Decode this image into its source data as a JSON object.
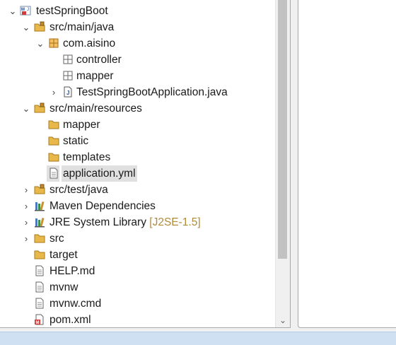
{
  "tree": {
    "rows": [
      {
        "label": "testSpringBoot",
        "icon": "maven-project-icon",
        "expanded": true
      },
      {
        "label": "src/main/java",
        "icon": "source-folder-icon",
        "expanded": true
      },
      {
        "label": "com.aisino",
        "icon": "package-icon",
        "expanded": true
      },
      {
        "label": "controller",
        "icon": "empty-package-icon"
      },
      {
        "label": "mapper",
        "icon": "empty-package-icon"
      },
      {
        "label": "TestSpringBootApplication.java",
        "icon": "java-file-icon",
        "expanded": false
      },
      {
        "label": "src/main/resources",
        "icon": "source-folder-icon",
        "expanded": true
      },
      {
        "label": "mapper",
        "icon": "folder-icon"
      },
      {
        "label": "static",
        "icon": "folder-icon"
      },
      {
        "label": "templates",
        "icon": "folder-icon"
      },
      {
        "label": "application.yml",
        "icon": "text-file-icon",
        "selected": true
      },
      {
        "label": "src/test/java",
        "icon": "source-folder-icon",
        "expanded": false
      },
      {
        "label": "Maven Dependencies",
        "icon": "library-icon",
        "expanded": false
      },
      {
        "label": "JRE System Library",
        "decoration": "[J2SE-1.5]",
        "icon": "library-icon",
        "expanded": false
      },
      {
        "label": "src",
        "icon": "folder-icon",
        "expanded": false
      },
      {
        "label": "target",
        "icon": "folder-icon"
      },
      {
        "label": "HELP.md",
        "icon": "text-file-icon"
      },
      {
        "label": "mvnw",
        "icon": "text-file-icon"
      },
      {
        "label": "mvnw.cmd",
        "icon": "text-file-icon"
      },
      {
        "label": "pom.xml",
        "icon": "xml-file-icon"
      }
    ]
  },
  "colors": {
    "selection": "#e0e0e0",
    "decoration": "#b08b3c",
    "folder": "#e8b84a",
    "status_strip": "#cfe0f3"
  }
}
